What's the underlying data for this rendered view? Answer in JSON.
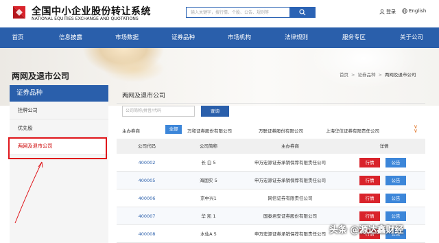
{
  "header": {
    "logo_cn": "全国中小企业股份转让系统",
    "logo_en": "NATIONAL EQUITIES EXCHANGE AND QUOTATIONS",
    "search_placeholder": "输入关键字，搜行情、个股、公告、规则等",
    "login_label": "登录",
    "lang_label": "English"
  },
  "nav": {
    "items": [
      "首页",
      "信息披露",
      "市场数据",
      "证券品种",
      "市场机构",
      "法律规则",
      "服务专区",
      "关于公司"
    ]
  },
  "page": {
    "heading": "两网及退市公司",
    "breadcrumb": [
      "首页",
      "证券品种",
      "两网及退市公司"
    ]
  },
  "sidebar": {
    "title": "证券品种",
    "items": [
      "挂牌公司",
      "优先股",
      "两网及退市公司"
    ],
    "active_index": 2
  },
  "main": {
    "title": "两网及退市公司",
    "query_placeholder": "公司简称/拼音/代码",
    "query_button": "查询",
    "filter_label": "主办券商",
    "filter_all": "全部",
    "filter_options": [
      "万和证券股份有限公司",
      "万联证券股份有限公司",
      "上海华信证券有限责任公司"
    ],
    "columns": [
      "公司代码",
      "公司简称",
      "主办券商",
      "详情"
    ],
    "rows": [
      {
        "code": "400002",
        "name": "长 白 5",
        "broker": "申万宏源证券承销保荐有限责任公司"
      },
      {
        "code": "400005",
        "name": "海国实 5",
        "broker": "申万宏源证券承销保荐有限责任公司"
      },
      {
        "code": "400006",
        "name": "京中兴1",
        "broker": "网信证券有限责任公司"
      },
      {
        "code": "400007",
        "name": "华 凯 1",
        "broker": "国泰君安证券股份有限公司"
      },
      {
        "code": "400008",
        "name": "水仙A 5",
        "broker": "申万宏源证券承销保荐有限责任公司"
      }
    ],
    "quote_button": "行情",
    "notice_button": "公告"
  },
  "watermark": "头条 @源达鑫财经",
  "colors": {
    "brand_blue": "#2a5fab",
    "accent_red": "#d9232b",
    "button_blue": "#3c86d9",
    "highlight_red": "#e0161b"
  }
}
